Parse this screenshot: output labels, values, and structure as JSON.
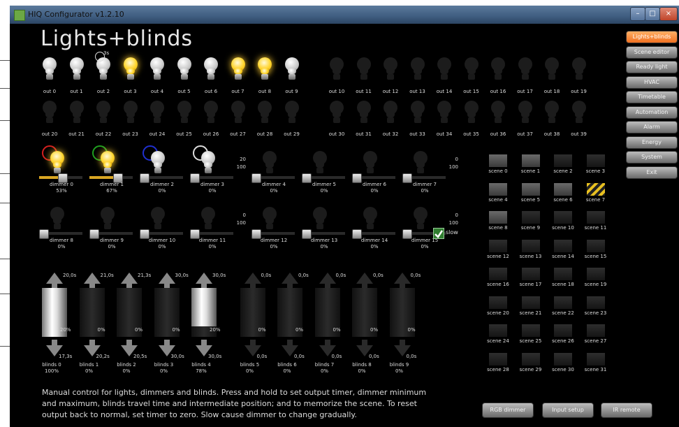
{
  "window": {
    "title": "HIQ Configurator v1.2.10",
    "minimize": "–",
    "maximize": "□",
    "close": "×"
  },
  "page": {
    "heading": "Lights+blinds"
  },
  "timer_badge": "3s",
  "outputs_row1": [
    {
      "label": "out 0",
      "state": "off"
    },
    {
      "label": "out 1",
      "state": "off"
    },
    {
      "label": "out 2",
      "state": "off"
    },
    {
      "label": "out 3",
      "state": "on"
    },
    {
      "label": "out 4",
      "state": "off"
    },
    {
      "label": "out 5",
      "state": "off"
    },
    {
      "label": "out 6",
      "state": "off"
    },
    {
      "label": "out 7",
      "state": "on"
    },
    {
      "label": "out 8",
      "state": "on"
    },
    {
      "label": "out 9",
      "state": "off"
    },
    {
      "label": "out 10",
      "state": "dark"
    },
    {
      "label": "out 11",
      "state": "dark"
    },
    {
      "label": "out 12",
      "state": "dark"
    },
    {
      "label": "out 13",
      "state": "dark"
    },
    {
      "label": "out 14",
      "state": "dark"
    },
    {
      "label": "out 15",
      "state": "dark"
    },
    {
      "label": "out 16",
      "state": "dark"
    },
    {
      "label": "out 17",
      "state": "dark"
    },
    {
      "label": "out 18",
      "state": "dark"
    },
    {
      "label": "out 19",
      "state": "dark"
    }
  ],
  "outputs_row2": [
    {
      "label": "out 20",
      "state": "dark"
    },
    {
      "label": "out 21",
      "state": "dark"
    },
    {
      "label": "out 22",
      "state": "dark"
    },
    {
      "label": "out 23",
      "state": "dark"
    },
    {
      "label": "out 24",
      "state": "dark"
    },
    {
      "label": "out 25",
      "state": "dark"
    },
    {
      "label": "out 26",
      "state": "dark"
    },
    {
      "label": "out 27",
      "state": "dark"
    },
    {
      "label": "out 28",
      "state": "dark"
    },
    {
      "label": "out 29",
      "state": "dark"
    },
    {
      "label": "out 30",
      "state": "dark"
    },
    {
      "label": "out 31",
      "state": "dark"
    },
    {
      "label": "out 32",
      "state": "dark"
    },
    {
      "label": "out 33",
      "state": "dark"
    },
    {
      "label": "out 34",
      "state": "dark"
    },
    {
      "label": "out 35",
      "state": "dark"
    },
    {
      "label": "out 36",
      "state": "dark"
    },
    {
      "label": "out 37",
      "state": "dark"
    },
    {
      "label": "out 38",
      "state": "dark"
    },
    {
      "label": "out 39",
      "state": "dark"
    }
  ],
  "dimmers_row1": [
    {
      "label": "dimmer 0",
      "percent": "53%",
      "level": 0.53,
      "state": "on",
      "ring": "#d42020"
    },
    {
      "label": "dimmer 1",
      "percent": "67%",
      "level": 0.67,
      "state": "on",
      "ring": "#20a020"
    },
    {
      "label": "dimmer 2",
      "percent": "0%",
      "level": 0,
      "state": "off",
      "ring": "#2030d0"
    },
    {
      "label": "dimmer 3",
      "percent": "0%",
      "level": 0,
      "state": "off",
      "ring": "#dddddd",
      "min": "20",
      "max": "100"
    },
    {
      "label": "dimmer 4",
      "percent": "0%",
      "level": 0,
      "state": "dark"
    },
    {
      "label": "dimmer 5",
      "percent": "0%",
      "level": 0,
      "state": "dark"
    },
    {
      "label": "dimmer 6",
      "percent": "0%",
      "level": 0,
      "state": "dark"
    },
    {
      "label": "dimmer 7",
      "percent": "0%",
      "level": 0,
      "state": "dark",
      "min": "0",
      "max": "100"
    }
  ],
  "dimmers_row2": [
    {
      "label": "dimmer 8",
      "percent": "0%",
      "level": 0,
      "state": "dark"
    },
    {
      "label": "dimmer 9",
      "percent": "0%",
      "level": 0,
      "state": "dark"
    },
    {
      "label": "dimmer 10",
      "percent": "0%",
      "level": 0,
      "state": "dark"
    },
    {
      "label": "dimmer 11",
      "percent": "0%",
      "level": 0,
      "state": "dark",
      "min": "0",
      "max": "100"
    },
    {
      "label": "dimmer 12",
      "percent": "0%",
      "level": 0,
      "state": "dark"
    },
    {
      "label": "dimmer 13",
      "percent": "0%",
      "level": 0,
      "state": "dark"
    },
    {
      "label": "dimmer 14",
      "percent": "0%",
      "level": 0,
      "state": "dark"
    },
    {
      "label": "dimmer 15",
      "percent": "0%",
      "level": 0,
      "state": "dark",
      "min": "0",
      "max": "100"
    }
  ],
  "slow": {
    "label": "slow",
    "checked": true
  },
  "blinds": [
    {
      "label": "blinds 0",
      "percent": "100%",
      "up_time": "20,0s",
      "down_time": "17,3s",
      "mid": "20%",
      "level": 1.0,
      "active": true
    },
    {
      "label": "blinds 1",
      "percent": "0%",
      "up_time": "21,0s",
      "down_time": "20,2s",
      "mid": "0%",
      "level": 0,
      "active": true
    },
    {
      "label": "blinds 2",
      "percent": "0%",
      "up_time": "21,3s",
      "down_time": "20,5s",
      "mid": "0%",
      "level": 0,
      "active": true
    },
    {
      "label": "blinds 3",
      "percent": "0%",
      "up_time": "30,0s",
      "down_time": "30,0s",
      "mid": "0%",
      "level": 0,
      "active": true
    },
    {
      "label": "blinds 4",
      "percent": "78%",
      "up_time": "30,0s",
      "down_time": "30,0s",
      "mid": "20%",
      "level": 0.78,
      "active": true
    },
    {
      "label": "blinds 5",
      "percent": "0%",
      "up_time": "0,0s",
      "down_time": "0,0s",
      "mid": "0%",
      "level": 0,
      "active": false
    },
    {
      "label": "blinds 6",
      "percent": "0%",
      "up_time": "0,0s",
      "down_time": "0,0s",
      "mid": "0%",
      "level": 0,
      "active": false
    },
    {
      "label": "blinds 7",
      "percent": "0%",
      "up_time": "0,0s",
      "down_time": "0,0s",
      "mid": "0%",
      "level": 0,
      "active": false
    },
    {
      "label": "blinds 8",
      "percent": "0%",
      "up_time": "0,0s",
      "down_time": "0,0s",
      "mid": "0%",
      "level": 0,
      "active": false
    },
    {
      "label": "blinds 9",
      "percent": "0%",
      "up_time": "0,0s",
      "down_time": "0,0s",
      "mid": "0%",
      "level": 0,
      "active": false
    }
  ],
  "scenes": [
    {
      "label": "scene 0",
      "style": "active"
    },
    {
      "label": "scene 1",
      "style": "active"
    },
    {
      "label": "scene 2",
      "style": "normal"
    },
    {
      "label": "scene 3",
      "style": "normal"
    },
    {
      "label": "scene 4",
      "style": "active"
    },
    {
      "label": "scene 5",
      "style": "active"
    },
    {
      "label": "scene 6",
      "style": "active"
    },
    {
      "label": "scene 7",
      "style": "yellow"
    },
    {
      "label": "scene 8",
      "style": "active"
    },
    {
      "label": "scene 9",
      "style": "normal"
    },
    {
      "label": "scene 10",
      "style": "normal"
    },
    {
      "label": "scene 11",
      "style": "normal"
    },
    {
      "label": "scene 12",
      "style": "normal"
    },
    {
      "label": "scene 13",
      "style": "normal"
    },
    {
      "label": "scene 14",
      "style": "normal"
    },
    {
      "label": "scene 15",
      "style": "normal"
    },
    {
      "label": "scene 16",
      "style": "normal"
    },
    {
      "label": "scene 17",
      "style": "normal"
    },
    {
      "label": "scene 18",
      "style": "normal"
    },
    {
      "label": "scene 19",
      "style": "normal"
    },
    {
      "label": "scene 20",
      "style": "normal"
    },
    {
      "label": "scene 21",
      "style": "normal"
    },
    {
      "label": "scene 22",
      "style": "normal"
    },
    {
      "label": "scene 23",
      "style": "normal"
    },
    {
      "label": "scene 24",
      "style": "normal"
    },
    {
      "label": "scene 25",
      "style": "normal"
    },
    {
      "label": "scene 26",
      "style": "normal"
    },
    {
      "label": "scene 27",
      "style": "normal"
    },
    {
      "label": "scene 28",
      "style": "normal"
    },
    {
      "label": "scene 29",
      "style": "normal"
    },
    {
      "label": "scene 30",
      "style": "normal"
    },
    {
      "label": "scene 31",
      "style": "normal"
    }
  ],
  "nav": [
    {
      "label": "Lights+blinds",
      "active": true
    },
    {
      "label": "Scene editor",
      "active": false
    },
    {
      "label": "Ready light",
      "active": false
    },
    {
      "label": "HVAC",
      "active": false
    },
    {
      "label": "Timetable",
      "active": false
    },
    {
      "label": "Automation",
      "active": false
    },
    {
      "label": "Alarm",
      "active": false
    },
    {
      "label": "Energy",
      "active": false
    },
    {
      "label": "System",
      "active": false
    },
    {
      "label": "Exit",
      "active": false
    }
  ],
  "bottom_buttons": {
    "rgb": "RGB dimmer",
    "input": "Input setup",
    "ir": "IR remote"
  },
  "description": "Manual control for lights, dimmers and blinds. Press and hold to set output timer, dimmer minimum and maximum, blinds travel time and intermediate position; and to memorize the scene. To reset output back to normal, set timer to zero. Slow cause dimmer to change gradually.",
  "colors": {
    "accent": "#f07020",
    "on": "#ffd62e",
    "dimmer_fill": "#d9a623"
  }
}
